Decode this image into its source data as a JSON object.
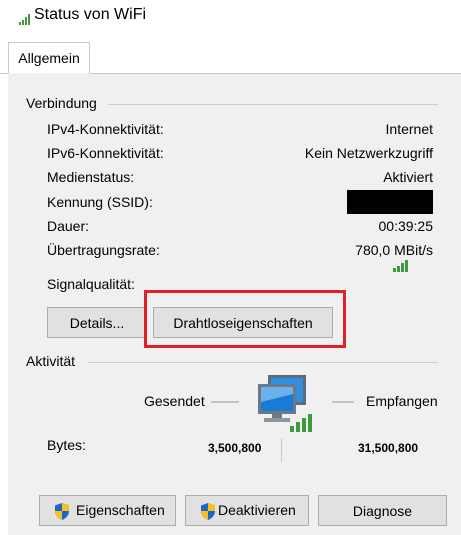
{
  "window": {
    "title": "Status von WiFi"
  },
  "tabs": [
    {
      "label": "Allgemein"
    }
  ],
  "connection": {
    "group_label": "Verbindung",
    "rows": [
      {
        "label": "IPv4-Konnektivität:",
        "value": "Internet"
      },
      {
        "label": "IPv6-Konnektivität:",
        "value": "Kein Netzwerkzugriff"
      },
      {
        "label": "Medienstatus:",
        "value": "Aktiviert"
      },
      {
        "label": "Kennung (SSID):",
        "value": ""
      },
      {
        "label": "Dauer:",
        "value": "00:39:25"
      },
      {
        "label": "Übertragungsrate:",
        "value": "780,0 MBit/s"
      }
    ],
    "signal_label": "Signalqualität:",
    "signal_bars": 4,
    "details_button": "Details...",
    "wireless_button": "Drahtloseigenschaften",
    "highlight_color": "#e0212c"
  },
  "activity": {
    "group_label": "Aktivität",
    "sent_label": "Gesendet",
    "received_label": "Empfangen",
    "bytes_label": "Bytes:",
    "bytes_sent": "3,500,800",
    "bytes_received": "31,500,800"
  },
  "footer": {
    "properties_button": "Eigenschaften",
    "disable_button": "Deaktivieren",
    "diagnose_button": "Diagnose"
  }
}
